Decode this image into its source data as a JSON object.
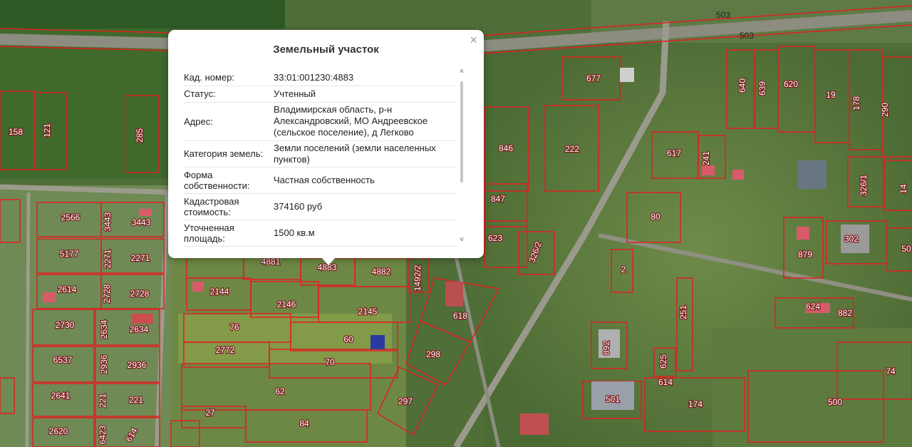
{
  "popup": {
    "title": "Земельный участок",
    "close_icon": "close-icon",
    "rows": [
      {
        "key": "Кад. номер:",
        "value": "33:01:001230:4883"
      },
      {
        "key": "Статус:",
        "value": "Учтенный"
      },
      {
        "key": "Адрес:",
        "value": "Владимирская область, р-н Александровский, МО Андреевское (сельское поселение), д Легково"
      },
      {
        "key": "Категория земель:",
        "value": "Земли поселений (земли населенных пунктов)"
      },
      {
        "key": "Форма собственности:",
        "value": "Частная собственность"
      },
      {
        "key": "Кадастровая стоимость:",
        "value": "374160 руб"
      },
      {
        "key": "Уточненная площадь:",
        "value": "1500 кв.м"
      }
    ],
    "scroll_up_icon": "chevron-up-icon",
    "scroll_down_icon": "chevron-down-icon"
  },
  "map": {
    "road_labels": [
      "503",
      "503"
    ],
    "parcel_labels": [
      "158",
      "121",
      "285",
      "846",
      "222",
      "677",
      "640",
      "639",
      "620",
      "19",
      "178",
      "290",
      "617",
      "241",
      "326/1",
      "14",
      "80",
      "302",
      "50",
      "879",
      "847",
      "623",
      "326/2",
      "2",
      "2566",
      "3443",
      "3443",
      "5177",
      "2271",
      "2271",
      "2614",
      "2728",
      "2728",
      "2730",
      "2634",
      "2634",
      "6537",
      "2936",
      "2936",
      "2641",
      "221",
      "221",
      "2620",
      "6423",
      "614",
      "4881",
      "4883",
      "4882",
      "1492/2",
      "2144",
      "2146",
      "2145",
      "76",
      "60",
      "2772",
      "70",
      "62",
      "27",
      "84",
      "618",
      "298",
      "297",
      "251",
      "624",
      "882",
      "892",
      "625",
      "614",
      "501",
      "174",
      "500",
      "74"
    ]
  }
}
